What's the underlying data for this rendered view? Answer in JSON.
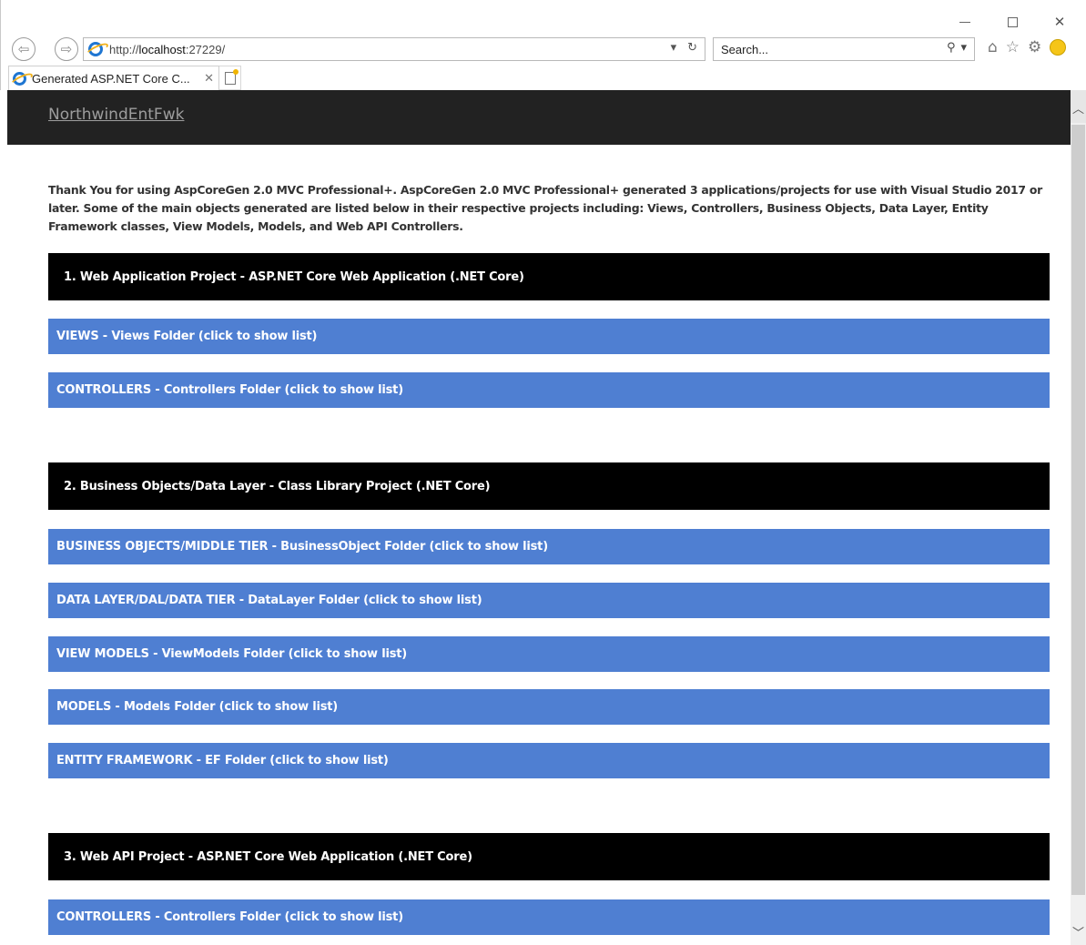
{
  "browser": {
    "url_prefix": "http://",
    "url_host": "localhost",
    "url_suffix": ":27229/",
    "search_placeholder": "Search...",
    "tab_title": "Generated ASP.NET Core C...",
    "tab_close": "✕",
    "back_glyph": "⇦",
    "forward_glyph": "⇨",
    "dropdown_glyph": "▾",
    "refresh_glyph": "↻",
    "search_glyph": "⚲",
    "home_glyph": "⌂",
    "favorites_glyph": "☆",
    "settings_glyph": "⚙",
    "minimize_label": "",
    "close_glyph": "✕",
    "icons": [
      "back-arrow-icon",
      "forward-arrow-icon",
      "ie-logo-icon",
      "refresh-icon",
      "search-icon",
      "home-icon",
      "favorites-star-icon",
      "gear-icon",
      "smiley-feedback-icon",
      "new-tab-icon"
    ]
  },
  "site": {
    "brand": "NorthwindEntFwk"
  },
  "intro": "Thank You for using AspCoreGen 2.0 MVC Professional+. AspCoreGen 2.0 MVC Professional+ generated 3 applications/projects for use with Visual Studio 2017 or later. Some of the main objects generated are listed below in their respective projects including: Views, Controllers, Business Objects, Data Layer, Entity Framework classes, View Models, Models, and Web API Controllers.",
  "sections": [
    {
      "title": "1. Web Application Project - ASP.NET Core Web Application (.NET Core)",
      "folders": [
        "VIEWS - Views Folder (click to show list)",
        "CONTROLLERS - Controllers Folder (click to show list)"
      ]
    },
    {
      "title": "2. Business Objects/Data Layer - Class Library Project (.NET Core)",
      "folders": [
        "BUSINESS OBJECTS/MIDDLE TIER - BusinessObject Folder (click to show list)",
        "DATA LAYER/DAL/DATA TIER - DataLayer Folder (click to show list)",
        "VIEW MODELS - ViewModels Folder (click to show list)",
        "MODELS - Models Folder (click to show list)",
        "ENTITY FRAMEWORK - EF Folder (click to show list)"
      ]
    },
    {
      "title": "3. Web API Project - ASP.NET Core Web Application (.NET Core)",
      "folders": [
        "CONTROLLERS - Controllers Folder (click to show list)"
      ]
    }
  ],
  "colors": {
    "header_bg": "#222222",
    "section_bg": "#000000",
    "folder_bg": "#4f7fd2"
  }
}
